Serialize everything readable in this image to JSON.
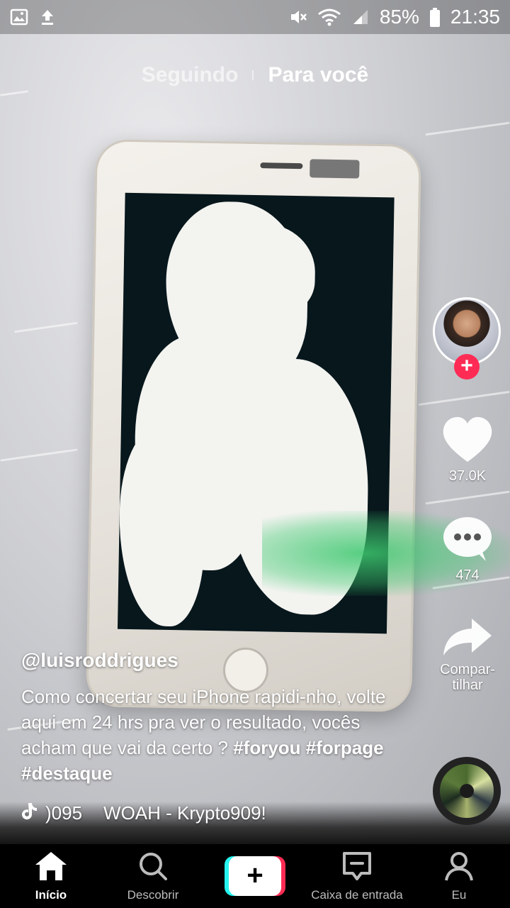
{
  "status_bar": {
    "battery": "85%",
    "time": "21:35",
    "icons": [
      "image-icon",
      "upload-icon",
      "mute-icon",
      "wifi-icon",
      "signal-icon",
      "battery-icon"
    ]
  },
  "top_tabs": {
    "following": "Seguindo",
    "for_you": "Para você"
  },
  "side_actions": {
    "likes": "37.0K",
    "comments": "474",
    "share": "Compar-\ntilhar"
  },
  "post": {
    "username": "@luisroddrigues",
    "caption_text": "Como concertar seu iPhone rapidi-nho, volte aqui em 24 hrs pra ver o resultado, vocês acham que vai da certo ?",
    "hashtags": "#foryou #forpage #destaque",
    "music_prefix": ")095",
    "music_title": "WOAH - Krypto909!"
  },
  "bottom_nav": {
    "home": "Início",
    "discover": "Descobrir",
    "inbox": "Caixa de entrada",
    "me": "Eu"
  },
  "colors": {
    "accent_red": "#fe2c55",
    "accent_cyan": "#25f4ee"
  }
}
